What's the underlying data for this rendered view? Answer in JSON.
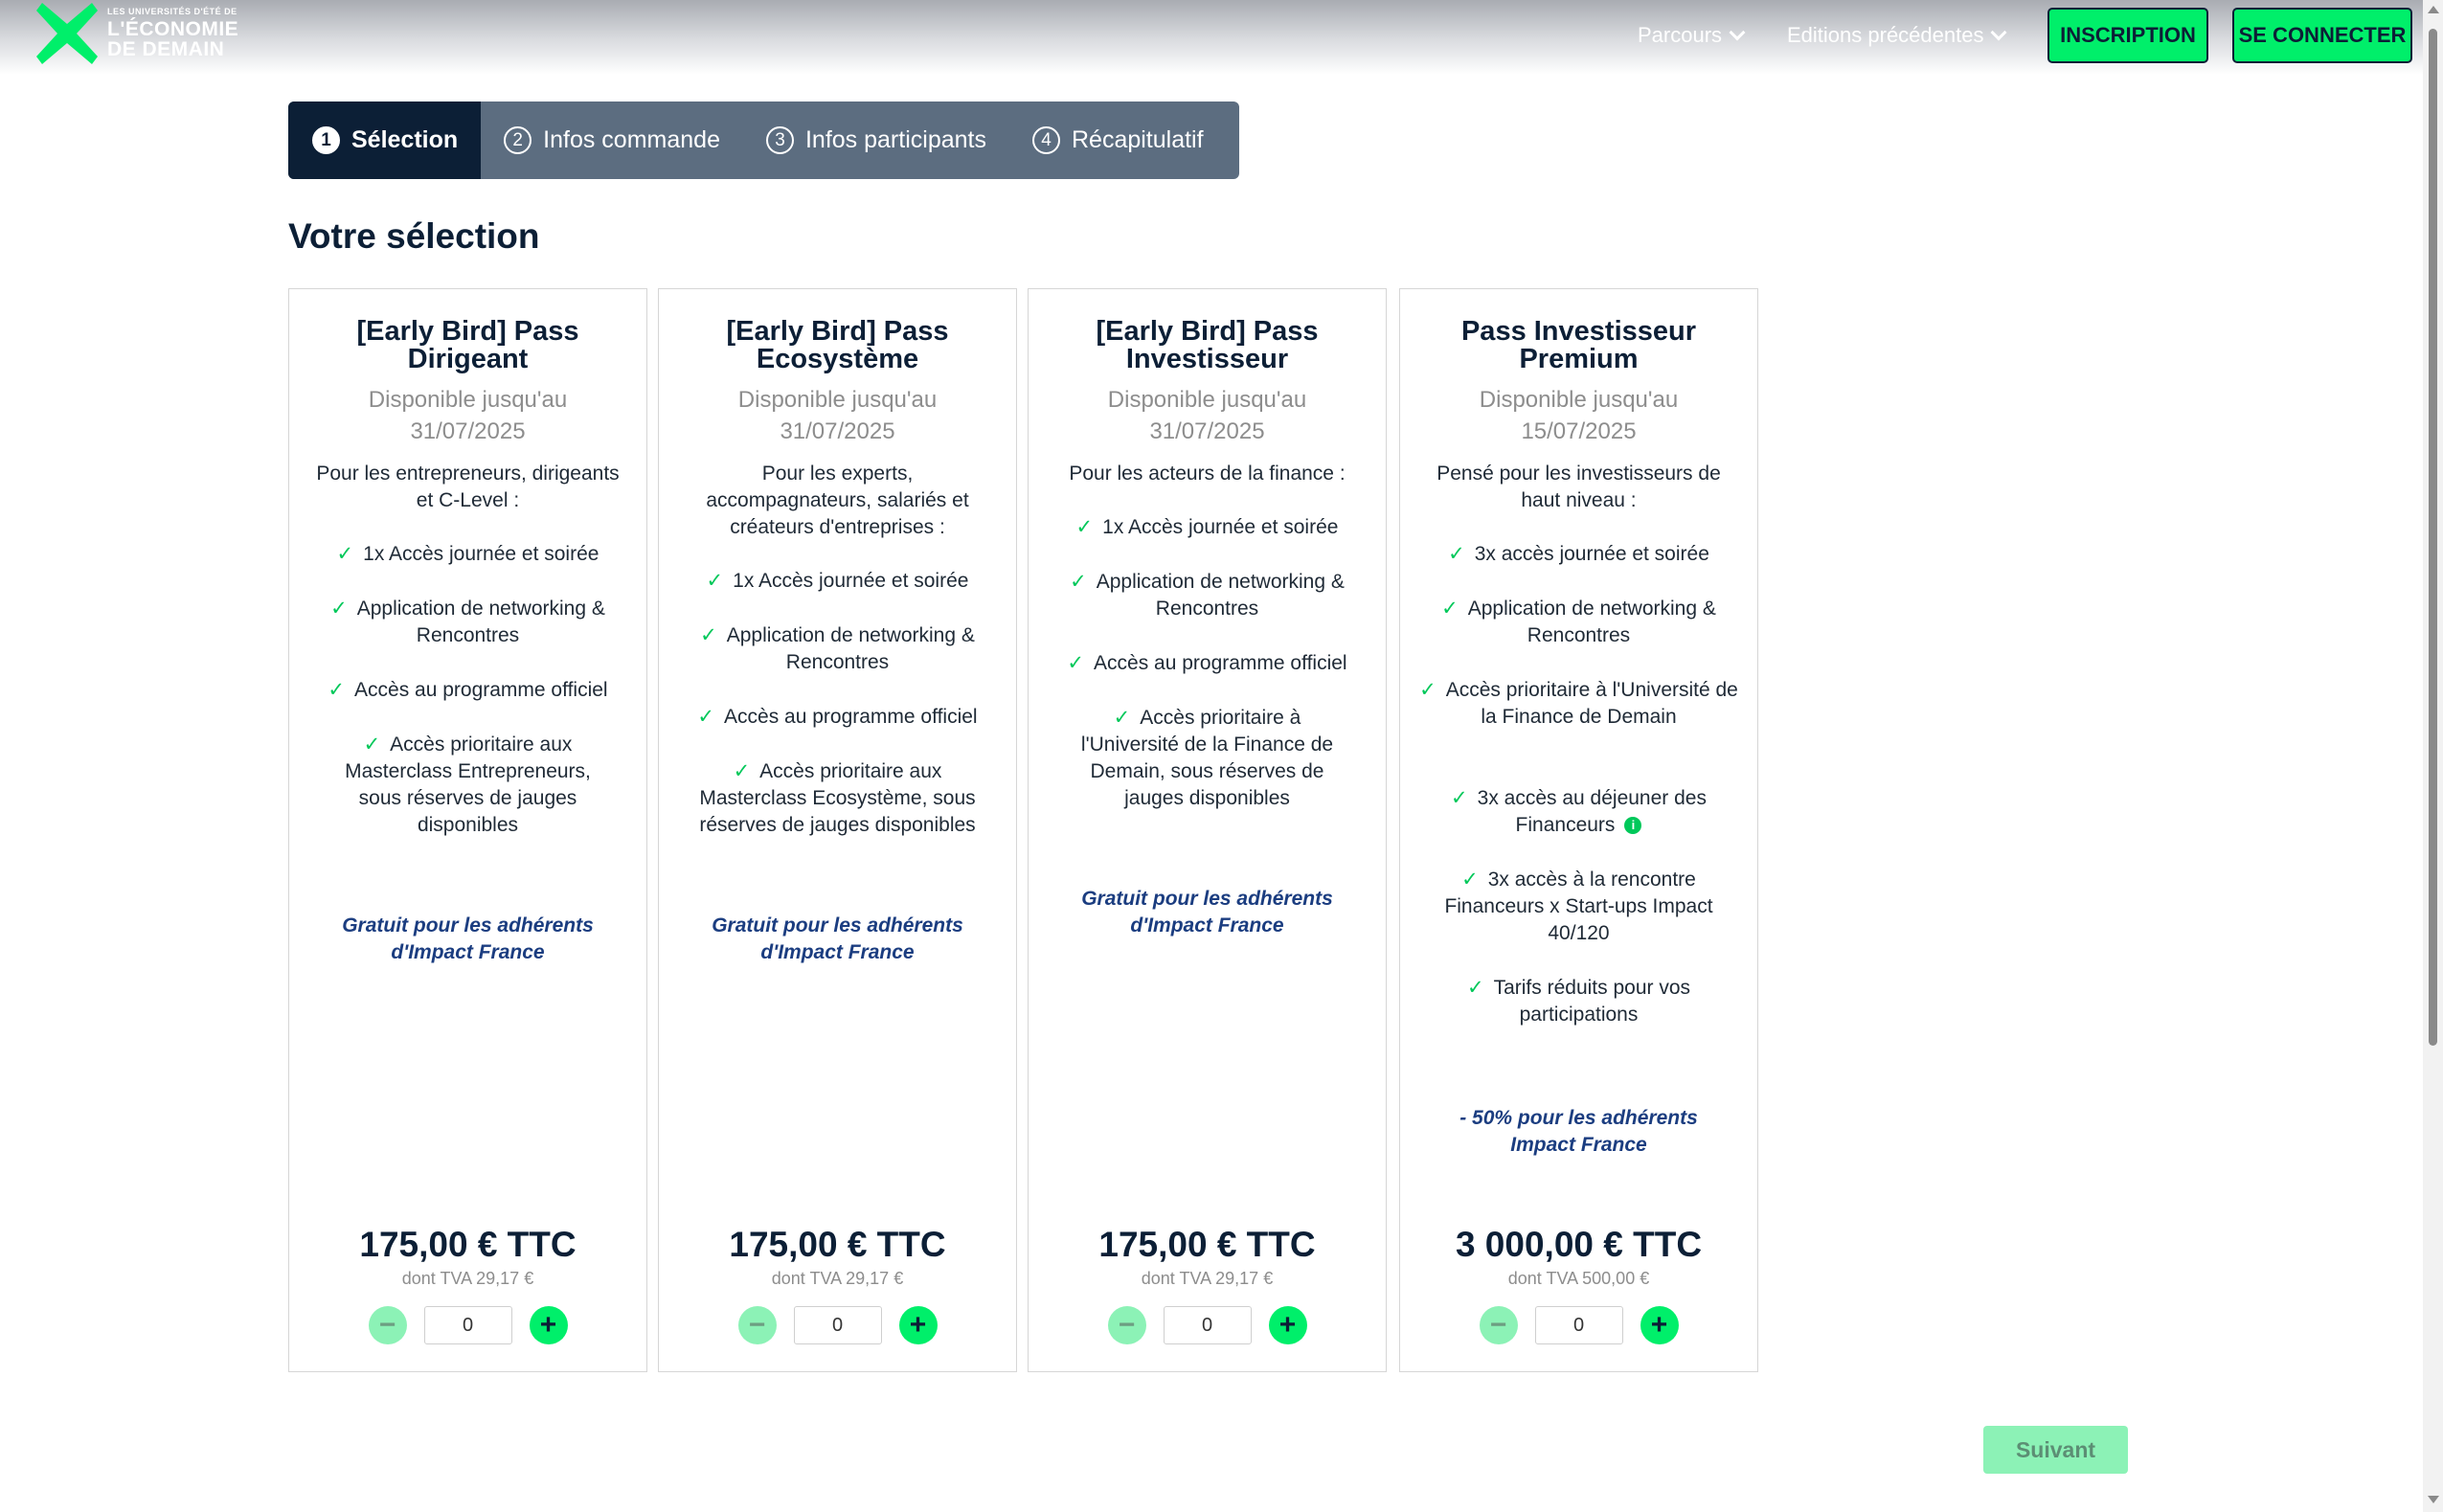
{
  "header": {
    "logo_small": "LES UNIVERSITÉS D'ÉTÉ DE",
    "logo_line1": "L'ÉCONOMIE",
    "logo_line2": "DE DEMAIN",
    "nav_parcours": "Parcours",
    "nav_editions": "Editions précédentes",
    "btn_inscription": "INSCRIPTION",
    "btn_connect": "SE CONNECTER"
  },
  "stepper": [
    {
      "num": "1",
      "label": "Sélection"
    },
    {
      "num": "2",
      "label": "Infos commande"
    },
    {
      "num": "3",
      "label": "Infos participants"
    },
    {
      "num": "4",
      "label": "Récapitulatif"
    }
  ],
  "page_title": "Votre sélection",
  "cards": [
    {
      "title": "[Early Bird] Pass Dirigeant",
      "avail_line1": "Disponible jusqu'au",
      "avail_line2": "31/07/2025",
      "intro": "Pour les entrepreneurs, dirigeants et C-Level :",
      "features": [
        "1x Accès journée et soirée",
        "Application de networking & Rencontres",
        "Accès au programme officiel",
        "Accès prioritaire aux Masterclass Entrepreneurs, sous réserves de jauges disponibles"
      ],
      "promo": "Gratuit pour les adhérents d'Impact France",
      "price": "175,00 € TTC",
      "tva": "dont TVA 29,17 €",
      "qty": "0"
    },
    {
      "title": "[Early Bird] Pass Ecosystème",
      "avail_line1": "Disponible jusqu'au",
      "avail_line2": "31/07/2025",
      "intro": "Pour les experts, accompagnateurs, salariés et créateurs d'entreprises :",
      "features": [
        "1x Accès journée et soirée",
        "Application de networking & Rencontres",
        "Accès au programme officiel",
        "Accès prioritaire aux Masterclass Ecosystème, sous réserves de jauges disponibles"
      ],
      "promo": "Gratuit pour les adhérents d'Impact France",
      "price": "175,00 € TTC",
      "tva": "dont TVA 29,17 €",
      "qty": "0"
    },
    {
      "title": "[Early Bird] Pass Investisseur",
      "avail_line1": "Disponible jusqu'au",
      "avail_line2": "31/07/2025",
      "intro": "Pour les acteurs de la finance :",
      "features": [
        "1x Accès journée et soirée",
        "Application de networking & Rencontres",
        "Accès au programme officiel",
        "Accès prioritaire à l'Université de la Finance de Demain, sous réserves de jauges disponibles"
      ],
      "promo": "Gratuit pour les adhérents d'Impact France",
      "price": "175,00 € TTC",
      "tva": "dont TVA 29,17 €",
      "qty": "0"
    },
    {
      "title": "Pass Investisseur Premium",
      "avail_line1": "Disponible jusqu'au",
      "avail_line2": "15/07/2025",
      "intro": "Pensé pour les investisseurs de haut niveau :",
      "features": [
        "3x accès journée et soirée",
        "Application de networking & Rencontres",
        "Accès prioritaire à l'Université de la Finance de Demain",
        "3x accès au déjeuner des Financeurs",
        "3x accès à la rencontre Financeurs x Start-ups Impact 40/120",
        "Tarifs réduits pour vos participations"
      ],
      "promo": "- 50% pour les adhérents Impact France",
      "price": "3 000,00 € TTC",
      "tva": "dont TVA 500,00 €",
      "qty": "0"
    }
  ],
  "btn_next": "Suivant",
  "colors": {
    "navy": "#0c1f36",
    "green": "#00ef6a",
    "check": "#00c85a",
    "promo": "#1b3d80"
  }
}
